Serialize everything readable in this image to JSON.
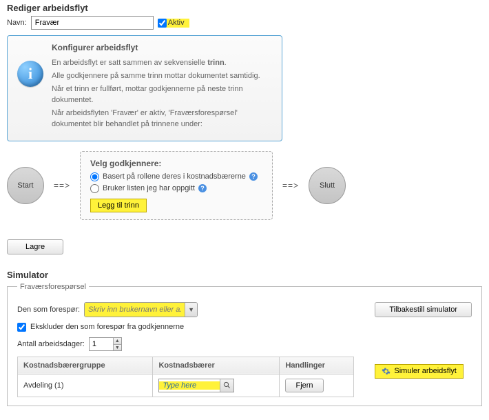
{
  "page": {
    "title": "Rediger arbeidsflyt",
    "name_label": "Navn:",
    "name_value": "Fravær",
    "active_label": "Aktiv"
  },
  "info": {
    "heading": "Konfigurer arbeidsflyt",
    "p1a": "En arbeidsflyt er satt sammen av sekvensielle ",
    "p1b_strong": "trinn",
    "p1c": ".",
    "p2": "Alle godkjennere på samme trinn mottar dokumentet samtidig.",
    "p3": "Når et trinn er fullført, mottar godkjennerne på neste trinn dokumentet.",
    "p4": "Når arbeidsflyten 'Fravær' er aktiv, 'Fraværsforespørsel' dokumentet blir behandlet på trinnene under:"
  },
  "flow": {
    "start": "Start",
    "end": "Slutt",
    "arrow": "==>"
  },
  "approvers": {
    "heading": "Velg godkjennere:",
    "opt1": "Basert på rollene deres i kostnadsbærerne",
    "opt2": "Bruker listen jeg har oppgitt",
    "add_step": "Legg til trinn"
  },
  "buttons": {
    "save": "Lagre",
    "reset_sim": "Tilbakestill simulator",
    "simulate": "Simuler arbeidsflyt",
    "remove": "Fjern"
  },
  "simulator": {
    "title": "Simulator",
    "legend": "Fraværsforespørsel",
    "requester_label": "Den som forespør:",
    "requester_placeholder": "Skriv inn brukernavn eller a...",
    "exclude_label": "Ekskluder den som forespør fra godkjennerne",
    "days_label": "Antall arbeidsdager:",
    "days_value": "1",
    "table": {
      "headers": [
        "Kostnadsbærergruppe",
        "Kostnadsbærer",
        "Handlinger"
      ],
      "row1_group": "Avdeling (1)",
      "type_here": "Type here"
    }
  }
}
